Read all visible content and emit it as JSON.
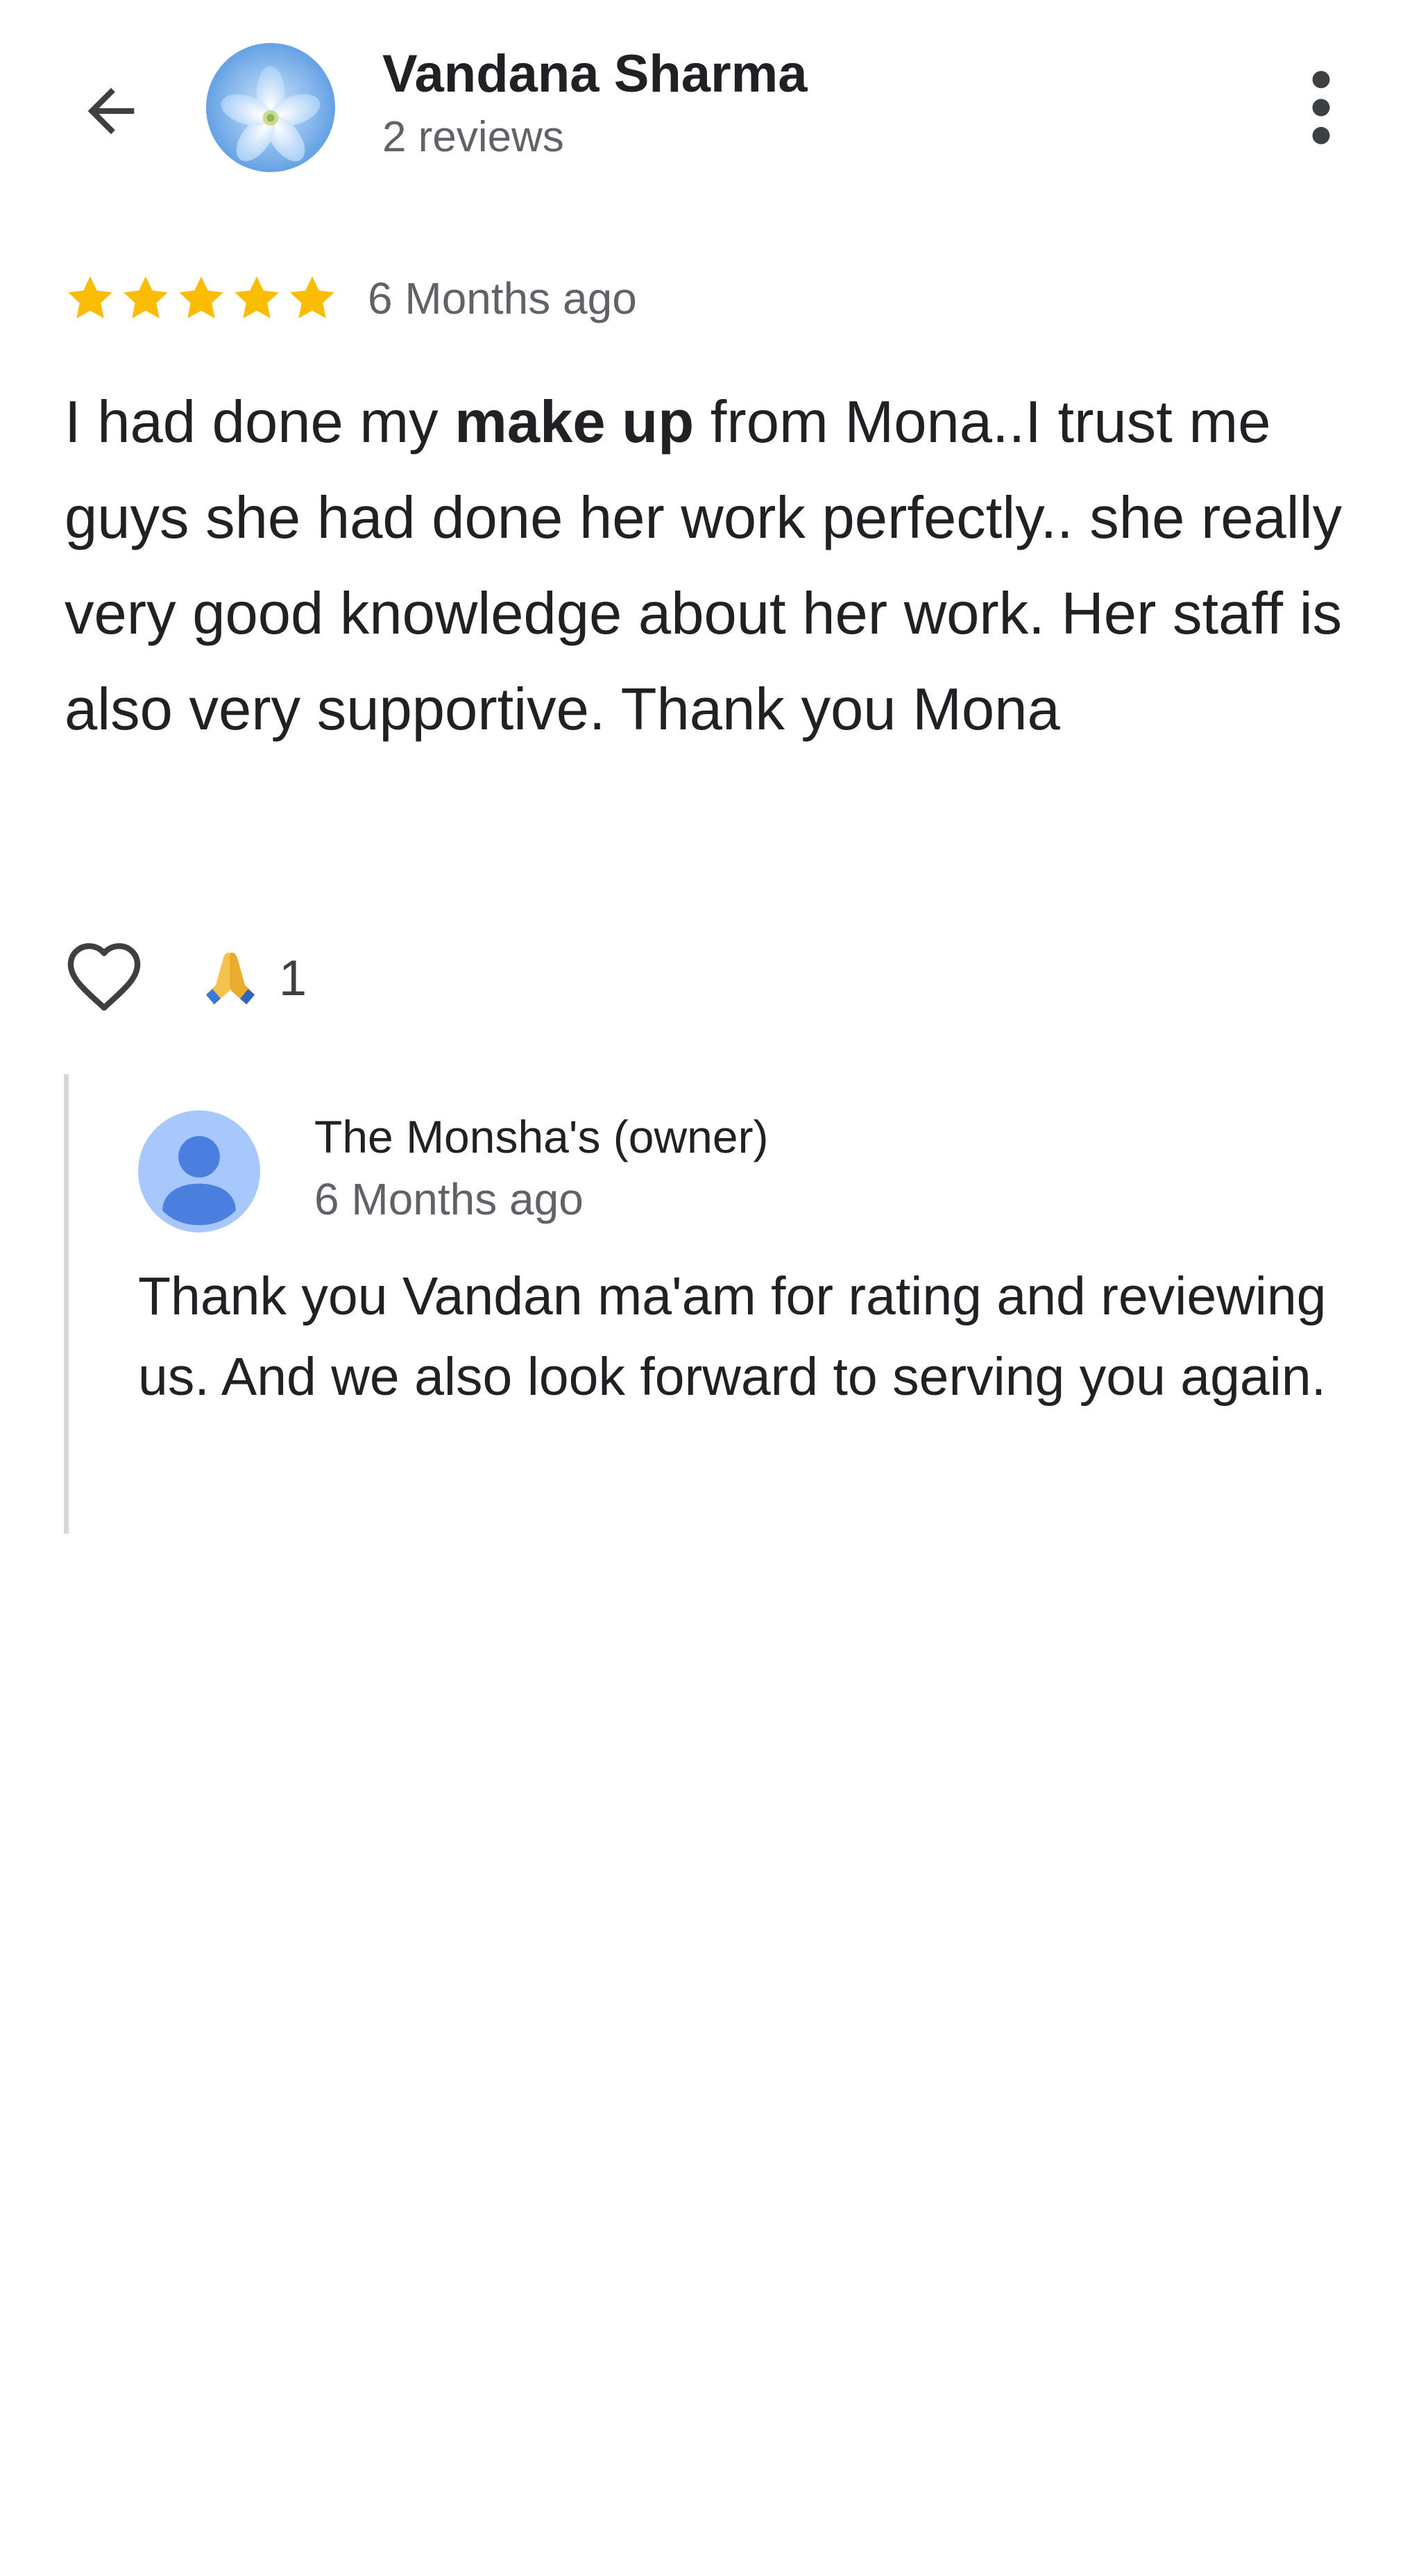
{
  "header": {
    "reviewer_name": "Vandana Sharma",
    "review_count": "2 reviews",
    "back_icon": "arrow-back-icon",
    "more_icon": "more-vert-icon",
    "avatar": "blue-flower-avatar"
  },
  "review": {
    "rating": 5,
    "rating_max": 5,
    "star_color": "#fbbc04",
    "date": "6 Months ago",
    "text_part1": "I had done my ",
    "text_highlight": "make up",
    "text_part2": " from Mona..I trust me guys she had done her work perfectly.. she really very good knowledge about her work. Her staff is also very supportive. Thank you Mona"
  },
  "reactions": {
    "like_icon": "heart-outline-icon",
    "emoji_icon": "folded-hands-emoji",
    "count": "1"
  },
  "owner_reply": {
    "name": "The Monsha's (owner)",
    "date": "6 Months ago",
    "text": "Thank you Vandan ma'am for rating and reviewing us. And we also look forward to serving you again.",
    "avatar_icon": "person-icon",
    "avatar_bg": "#a8c7fa",
    "avatar_fg": "#4a7fe0"
  }
}
